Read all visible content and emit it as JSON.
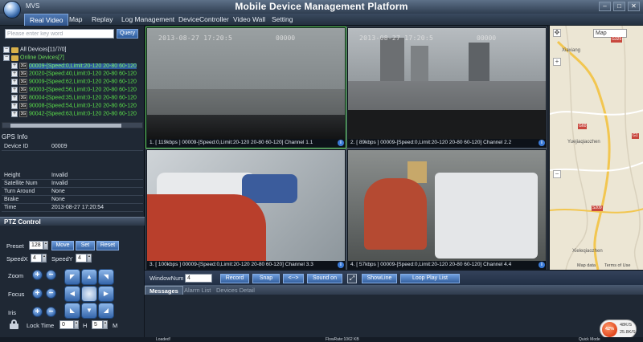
{
  "app": {
    "short_name": "MVS",
    "title": "Mobile Device Management Platform"
  },
  "menu": [
    "Real Video",
    "Map",
    "Replay",
    "Log Management",
    "DeviceController",
    "Video Wall",
    "Setting"
  ],
  "search": {
    "placeholder": "Please enter key word",
    "query_label": "Query"
  },
  "tree": {
    "all_devices": "All Devices[11/7/0]",
    "online_devices": "Online Devices[7]",
    "devices": [
      {
        "badge": "3G",
        "text": "00009-[Speed:0,Limit:20-120 20-80 60-120"
      },
      {
        "badge": "3G",
        "text": "20020-[Speed:40,Limit:0-120 20-80 60-120"
      },
      {
        "badge": "3G",
        "text": "90009-[Speed:62,Limit:0-120 20-80 60-120"
      },
      {
        "badge": "3G",
        "text": "90003-[Speed:56,Limit:0-120 20-80 60-120"
      },
      {
        "badge": "3G",
        "text": "80004-[Speed:35,Limit:0-120 20-80 60-120"
      },
      {
        "badge": "3G",
        "text": "90008-[Speed:54,Limit:0-120 20-80 60-120"
      },
      {
        "badge": "3G",
        "text": "90042-[Speed:63,Limit:0-120 20-80 60-120"
      }
    ]
  },
  "gps": {
    "title": "GPS Info",
    "rows": [
      {
        "key": "Device ID",
        "value": "00009"
      },
      {
        "key": "Height",
        "value": "Invalid"
      },
      {
        "key": "Satellite Num",
        "value": "Invalid"
      },
      {
        "key": "Turn Around",
        "value": "None"
      },
      {
        "key": "Brake",
        "value": "None"
      },
      {
        "key": "Time",
        "value": "2013-08-27 17:20:54"
      }
    ]
  },
  "ptz": {
    "title": "PTZ Control",
    "preset_label": "Preset",
    "preset_value": "128",
    "move_label": "Move",
    "set_label": "Set",
    "reset_label": "Reset",
    "speedx_label": "SpeedX",
    "speedx_value": "4",
    "speedy_label": "SpeedY",
    "speedy_value": "4",
    "zoom_label": "Zoom",
    "focus_label": "Focus",
    "iris_label": "Iris",
    "lock_time_label": "Lock Time",
    "lock_h_value": "0",
    "h_label": "H",
    "lock_m_value": "5",
    "m_label": "M"
  },
  "video": {
    "stamp": "2013-08-27 17:20:5",
    "stamp_id": "00000",
    "cells": [
      {
        "caption": "1. [ 119kbps ] 00009-[Speed:0,Limit:20-120 20-80 60-120] Channel 1.1"
      },
      {
        "caption": "2. [ 89kbps ] 00009-[Speed:0,Limit:20-120 20-80 60-120] Channel 2.2"
      },
      {
        "caption": "3. [ 100kbps ] 00009-[Speed:0,Limit:20-120 20-80 60-120] Channel 3.3"
      },
      {
        "caption": "4. [ 57kbps ] 00009-[Speed:0,Limit:20-120 20-80 60-120] Channel 4.4"
      }
    ]
  },
  "map": {
    "type_select": "Map",
    "places": [
      "Xiaxiang",
      "Yuejiaqiaozhen",
      "Xieleqiaozhen"
    ],
    "shields": [
      "G325",
      "G60",
      "S209",
      "G1"
    ],
    "footer_data": "Map data",
    "footer_terms": "Terms of Use"
  },
  "toolbar": {
    "window_num_label": "WindowNum",
    "window_num_value": "4",
    "record": "Record",
    "snap": "Snap",
    "arrow": "<-->",
    "sound_on": "Sound on",
    "show_line": "ShowLine",
    "loop_play_list": "Loop Play List"
  },
  "messages": {
    "tabs": [
      "Messages",
      "Alarm List",
      "Devices Detail"
    ]
  },
  "tray": {
    "percent": "42%",
    "up": "48K/S",
    "down": "25.8K/S"
  },
  "status": {
    "left": "Loaded!",
    "center": "FlowRate:1062 KB",
    "right": "Quick Mode"
  },
  "colors": {
    "accent": "#3d6fb3",
    "online_green": "#5ae04a",
    "active_frame": "#5fd45a"
  }
}
